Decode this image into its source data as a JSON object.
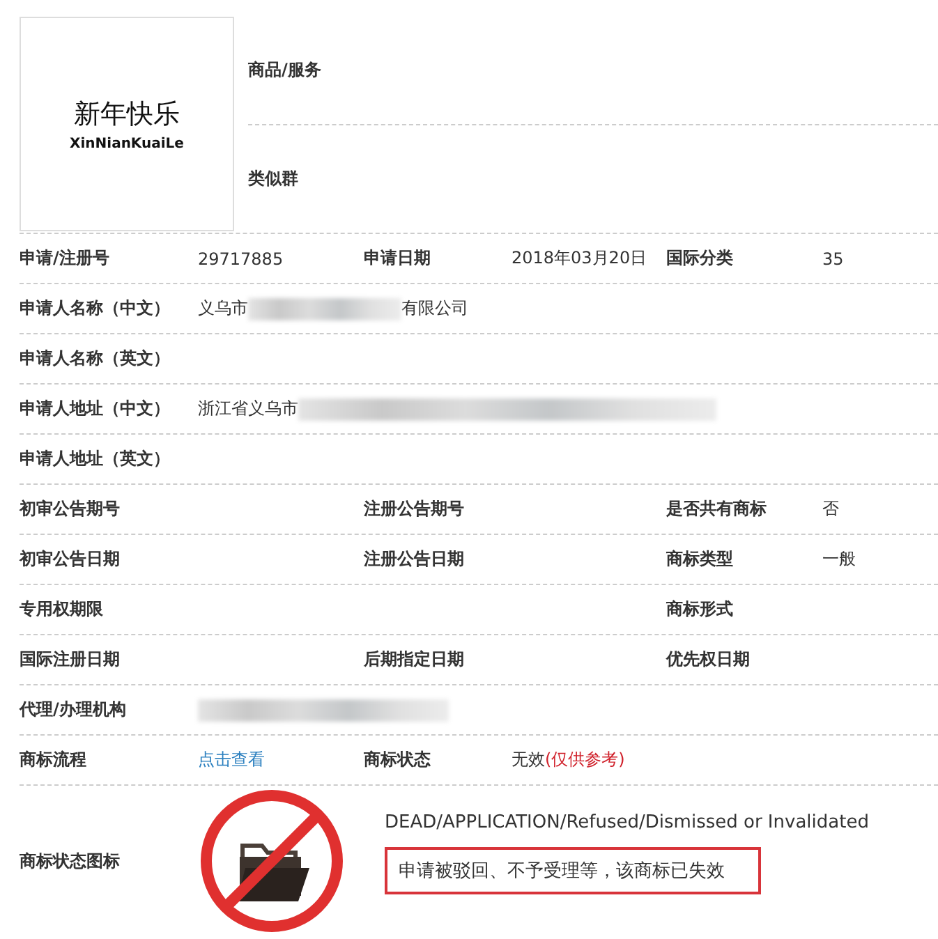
{
  "logo": {
    "title": "新年快乐",
    "subtitle": "XinNianKuaiLe"
  },
  "top_fields": [
    {
      "label": "商品/服务"
    },
    {
      "label": "类似群"
    }
  ],
  "rows": [
    {
      "kind": "fields",
      "left": {
        "label": "申请/注册号",
        "value": "29717885"
      },
      "middle": {
        "label": "申请日期",
        "value": "2018年03月20日"
      },
      "right": {
        "label": "国际分类",
        "value": "35"
      }
    },
    {
      "kind": "redacted",
      "label": "申请人名称（中文）",
      "value_start": "义乌市",
      "value_end": "有限公司"
    },
    {
      "kind": "fields",
      "left": {
        "label": "申请人名称（英文）"
      }
    },
    {
      "kind": "redacted",
      "label": "申请人地址（中文）",
      "value_start": "浙江省义乌市"
    },
    {
      "kind": "fields",
      "left": {
        "label": "申请人地址（英文）"
      }
    },
    {
      "kind": "fields",
      "left": {
        "label": "初审公告期号"
      },
      "middle": {
        "label": "注册公告期号"
      },
      "right": {
        "label": "是否共有商标",
        "value": "否"
      }
    },
    {
      "kind": "fields",
      "left": {
        "label": "初审公告日期"
      },
      "middle": {
        "label": "注册公告日期"
      },
      "right": {
        "label": "商标类型",
        "value": "一般"
      }
    },
    {
      "kind": "fields",
      "left": {
        "label": "专用权期限"
      },
      "right": {
        "label": "商标形式"
      }
    },
    {
      "kind": "fields",
      "left": {
        "label": "国际注册日期"
      },
      "middle": {
        "label": "后期指定日期"
      },
      "right": {
        "label": "优先权日期"
      }
    },
    {
      "kind": "redacted",
      "label": "代理/办理机构"
    },
    {
      "kind": "fields",
      "left": {
        "label": "商标流程",
        "link": "点击查看"
      },
      "middle": {
        "label": "商标状态",
        "value": "无效",
        "note": "(仅供参考)"
      }
    }
  ],
  "status": {
    "label": "商标状态图标",
    "english": "DEAD/APPLICATION/Refused/Dismissed or Invalidated",
    "chinese": "申请被驳回、不予受理等，该商标已失效"
  }
}
